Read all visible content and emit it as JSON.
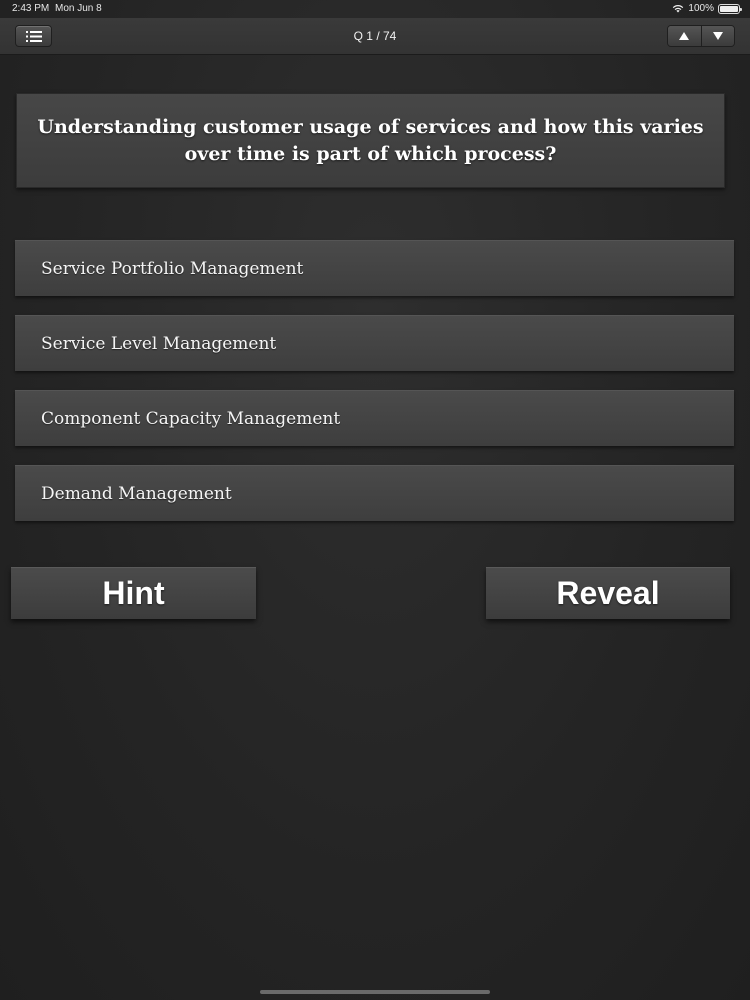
{
  "status_bar": {
    "time": "2:43 PM",
    "date": "Mon Jun 8",
    "battery": "100%",
    "battery_level": 1.0
  },
  "navbar": {
    "title": "Q 1 / 74",
    "menu_icon": "list-icon",
    "prev_icon": "arrow-up-icon",
    "next_icon": "arrow-down-icon"
  },
  "question": {
    "text": "Understanding customer usage of services and how this varies over time is part of which process?"
  },
  "answers": [
    {
      "label": "Service Portfolio Management"
    },
    {
      "label": "Service Level Management"
    },
    {
      "label": "Component Capacity Management"
    },
    {
      "label": "Demand Management"
    }
  ],
  "actions": {
    "hint_label": "Hint",
    "reveal_label": "Reveal"
  },
  "colors": {
    "background": "#262626",
    "card": "#444444",
    "text": "#ffffff"
  }
}
